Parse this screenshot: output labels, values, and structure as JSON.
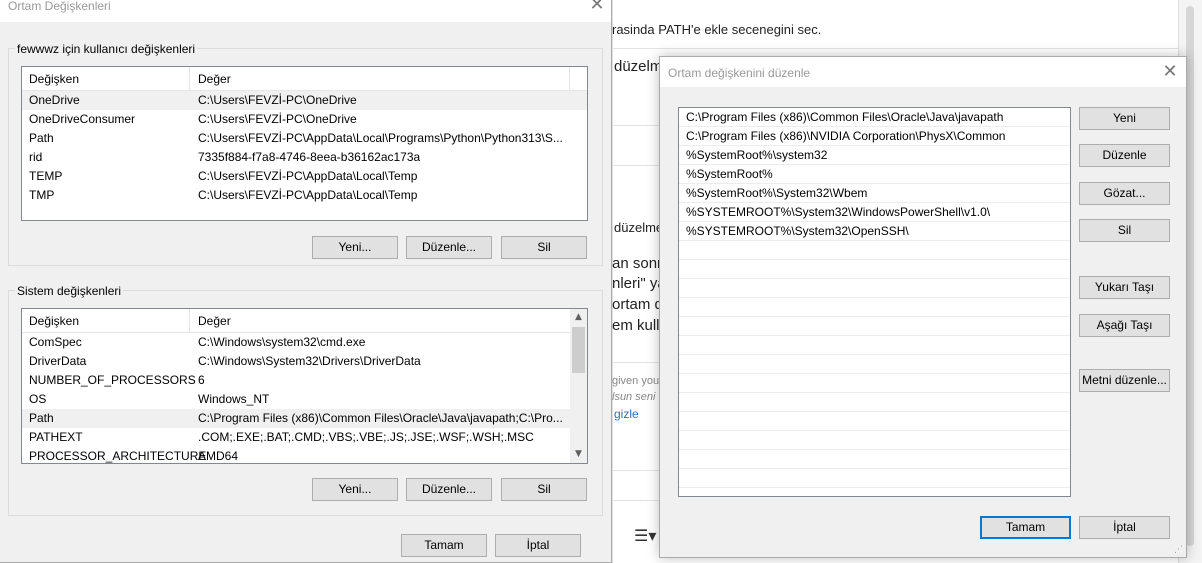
{
  "background": {
    "line1": "rasinda PATH'e ekle secenegini sec.",
    "line2": "düzelm",
    "line3": "düzelme",
    "line4": "an sonr",
    "line5": "nleri\" ya",
    "line6": "ortam d",
    "line7": "em kulla",
    "small1": "given you",
    "small2": "lsun seni",
    "link": "gizle",
    "toolbar_icon": "list-icon"
  },
  "left_dialog": {
    "title": "Ortam Değişkenleri",
    "user_group": {
      "legend": "fewwwz için kullanıcı değişkenleri",
      "headers": [
        "Değişken",
        "Değer"
      ],
      "rows": [
        {
          "name": "OneDrive",
          "value": "C:\\Users\\FEVZİ-PC\\OneDrive"
        },
        {
          "name": "OneDriveConsumer",
          "value": "C:\\Users\\FEVZİ-PC\\OneDrive"
        },
        {
          "name": "Path",
          "value": "C:\\Users\\FEVZİ-PC\\AppData\\Local\\Programs\\Python\\Python313\\S..."
        },
        {
          "name": "rid",
          "value": "7335f884-f7a8-4746-8eea-b36162ac173a"
        },
        {
          "name": "TEMP",
          "value": "C:\\Users\\FEVZİ-PC\\AppData\\Local\\Temp"
        },
        {
          "name": "TMP",
          "value": "C:\\Users\\FEVZİ-PC\\AppData\\Local\\Temp"
        }
      ],
      "buttons": {
        "new": "Yeni...",
        "edit": "Düzenle...",
        "delete": "Sil"
      }
    },
    "system_group": {
      "legend": "Sistem değişkenleri",
      "headers": [
        "Değişken",
        "Değer"
      ],
      "rows": [
        {
          "name": "ComSpec",
          "value": "C:\\Windows\\system32\\cmd.exe"
        },
        {
          "name": "DriverData",
          "value": "C:\\Windows\\System32\\Drivers\\DriverData"
        },
        {
          "name": "NUMBER_OF_PROCESSORS",
          "value": "6"
        },
        {
          "name": "OS",
          "value": "Windows_NT"
        },
        {
          "name": "Path",
          "value": "C:\\Program Files (x86)\\Common Files\\Oracle\\Java\\javapath;C:\\Pro..."
        },
        {
          "name": "PATHEXT",
          "value": ".COM;.EXE;.BAT;.CMD;.VBS;.VBE;.JS;.JSE;.WSF;.WSH;.MSC"
        },
        {
          "name": "PROCESSOR_ARCHITECTURE",
          "value": "AMD64"
        }
      ],
      "buttons": {
        "new": "Yeni...",
        "edit": "Düzenle...",
        "delete": "Sil"
      }
    },
    "ok": "Tamam",
    "cancel": "İptal"
  },
  "right_dialog": {
    "title": "Ortam değişkenini düzenle",
    "paths": [
      "C:\\Program Files (x86)\\Common Files\\Oracle\\Java\\javapath",
      "C:\\Program Files (x86)\\NVIDIA Corporation\\PhysX\\Common",
      "%SystemRoot%\\system32",
      "%SystemRoot%",
      "%SystemRoot%\\System32\\Wbem",
      "%SYSTEMROOT%\\System32\\WindowsPowerShell\\v1.0\\",
      "%SYSTEMROOT%\\System32\\OpenSSH\\"
    ],
    "empty_rows": 13,
    "buttons": {
      "new": "Yeni",
      "edit": "Düzenle",
      "browse": "Gözat...",
      "delete": "Sil",
      "move_up": "Yukarı Taşı",
      "move_down": "Aşağı Taşı",
      "edit_text": "Metni düzenle..."
    },
    "ok": "Tamam",
    "cancel": "İptal"
  }
}
